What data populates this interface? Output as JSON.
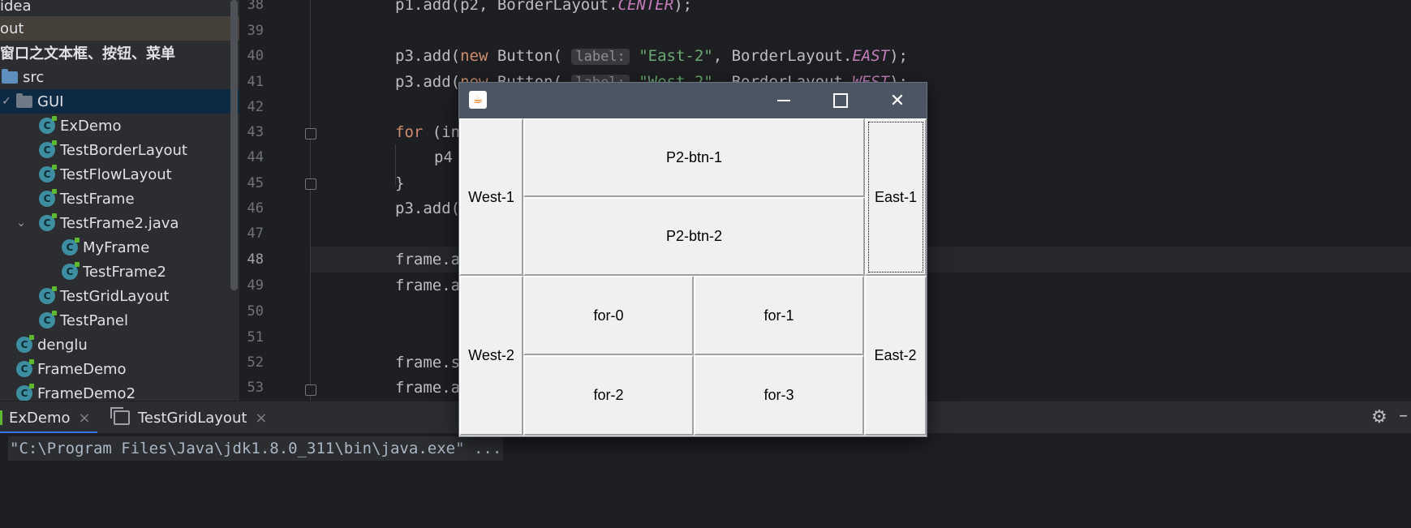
{
  "project_tree": {
    "rows": [
      {
        "label": "idea",
        "style": "folder"
      },
      {
        "label": "out",
        "style": "folder"
      },
      {
        "label": "窗口之文本框、按钮、菜单",
        "style": "module"
      },
      {
        "label": "src",
        "style": "src"
      },
      {
        "label": "GUI",
        "style": "package"
      },
      {
        "label": "ExDemo",
        "style": "class"
      },
      {
        "label": "TestBorderLayout",
        "style": "class"
      },
      {
        "label": "TestFlowLayout",
        "style": "class"
      },
      {
        "label": "TestFrame",
        "style": "class"
      },
      {
        "label": "TestFrame2.java",
        "style": "class"
      },
      {
        "label": "MyFrame",
        "style": "class"
      },
      {
        "label": "TestFrame2",
        "style": "class"
      },
      {
        "label": "TestGridLayout",
        "style": "class"
      },
      {
        "label": "TestPanel",
        "style": "class"
      },
      {
        "label": "denglu",
        "style": "class"
      },
      {
        "label": "FrameDemo",
        "style": "class"
      },
      {
        "label": "FrameDemo2",
        "style": "class"
      }
    ],
    "class_icon_letter": "C"
  },
  "editor": {
    "line_numbers": [
      "38",
      "39",
      "40",
      "41",
      "42",
      "43",
      "44",
      "45",
      "46",
      "47",
      "48",
      "49",
      "50",
      "51",
      "52",
      "53"
    ],
    "current_line": "48",
    "lines": {
      "l38": {
        "a": "p1.add(p2, BorderLayout.",
        "b": "CENTER",
        "c": ");"
      },
      "l40": {
        "a": "p3.add(",
        "kw": "new",
        "b": " Button( ",
        "hint": "label:",
        "str": " \"East-2\"",
        "c": ", BorderLayout.",
        "const": "EAST",
        "d": ");"
      },
      "l41": {
        "a": "p3.add(",
        "kw": "new",
        "b": " Button( ",
        "hint": "label:",
        "str": " \"West-2\"",
        "c": ", BorderLayout.",
        "const": "WEST",
        "d": ");"
      },
      "l43": {
        "kw": "for",
        "a": " (in"
      },
      "l44": {
        "a": "p4"
      },
      "l45": {
        "a": "}"
      },
      "l46": {
        "a": "p3.add("
      },
      "l48": {
        "a": "frame.a"
      },
      "l49": {
        "a": "frame.a"
      },
      "l52": {
        "a": "frame.s"
      },
      "l53": {
        "a": "frame.a"
      }
    }
  },
  "bottom_panel": {
    "tabs": [
      {
        "label": "ExDemo",
        "close": "×"
      },
      {
        "label": "TestGridLayout",
        "close": "×"
      }
    ],
    "console_text": "\"C:\\Program Files\\Java\\jdk1.8.0_311\\bin\\java.exe\" ...",
    "icons": {
      "settings": "gear-icon",
      "hide": "minimize-icon"
    }
  },
  "java_window": {
    "title_icon": "java-icon",
    "controls": {
      "minimize": "minimize-icon",
      "maximize": "maximize-icon",
      "close": "✕"
    },
    "buttons": {
      "west1": "West-1",
      "p2_btn_1": "P2-btn-1",
      "p2_btn_2": "P2-btn-2",
      "east1": "East-1",
      "west2": "West-2",
      "for0": "for-0",
      "for1": "for-1",
      "for2": "for-2",
      "for3": "for-3",
      "east2": "East-2"
    }
  },
  "colors": {
    "ide_bg": "#1e1f22",
    "panel_bg": "#2b2d30",
    "keyword": "#cf8e6d",
    "string": "#6aab73",
    "constant": "#c77dbb",
    "awt_bg": "#f0f0f0",
    "title_bar": "#4b5563"
  }
}
